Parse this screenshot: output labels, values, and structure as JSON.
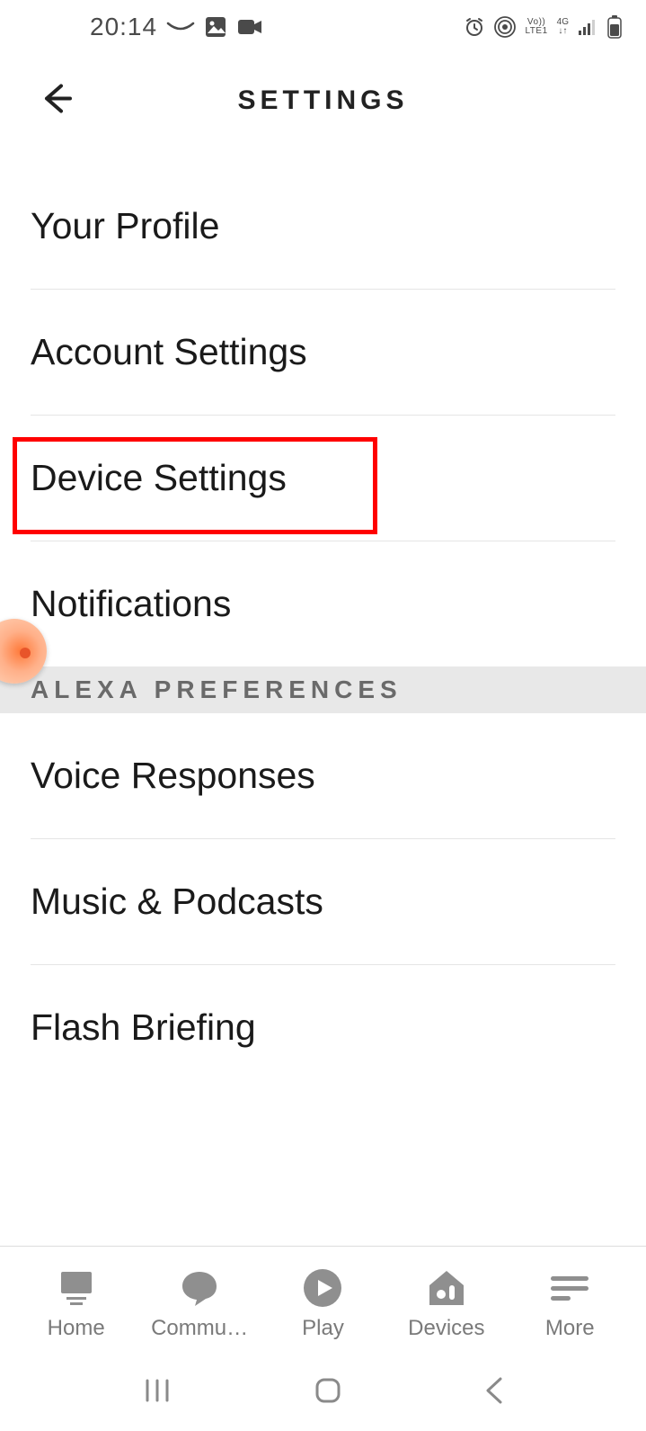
{
  "status": {
    "time": "20:14",
    "lte": "LTE1",
    "volte": "Vo))",
    "net": "4G"
  },
  "header": {
    "title": "SETTINGS"
  },
  "settings": {
    "items": [
      {
        "label": "Your Profile"
      },
      {
        "label": "Account Settings"
      },
      {
        "label": "Device Settings"
      },
      {
        "label": "Notifications"
      }
    ]
  },
  "section_header": "ALEXA PREFERENCES",
  "prefs": {
    "items": [
      {
        "label": "Voice Responses"
      },
      {
        "label": "Music & Podcasts"
      },
      {
        "label": "Flash Briefing"
      }
    ]
  },
  "nav": {
    "items": [
      {
        "label": "Home"
      },
      {
        "label": "Commu…"
      },
      {
        "label": "Play"
      },
      {
        "label": "Devices"
      },
      {
        "label": "More"
      }
    ]
  }
}
